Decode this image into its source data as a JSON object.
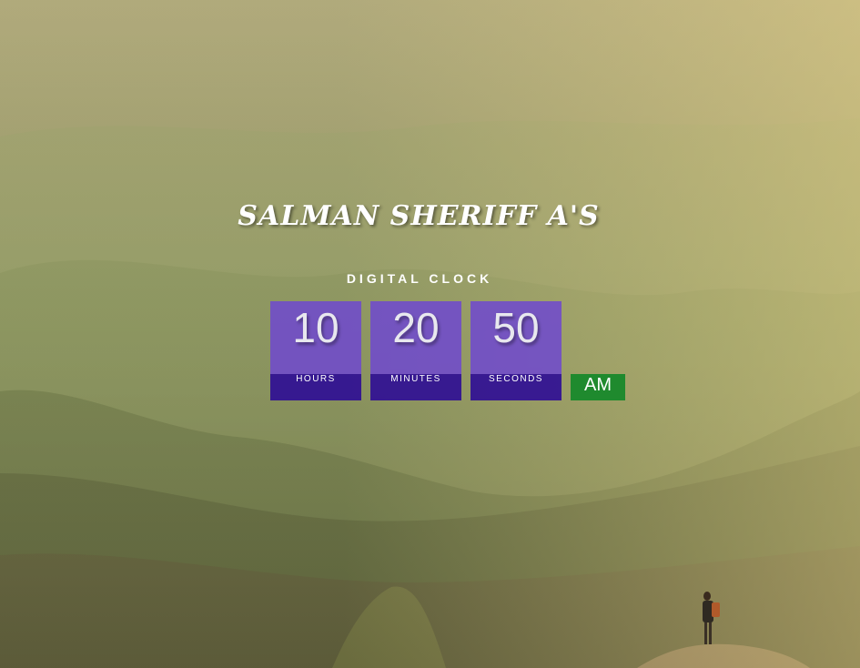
{
  "header": {
    "title": "SALMAN SHERIFF A'S",
    "subtitle": "DIGITAL CLOCK"
  },
  "clock": {
    "hours": {
      "value": "10",
      "label": "HOURS"
    },
    "minutes": {
      "value": "20",
      "label": "MINUTES"
    },
    "seconds": {
      "value": "50",
      "label": "SECONDS"
    },
    "period": "AM"
  },
  "colors": {
    "box_top": "#6e48d0",
    "box_bottom": "#2e0c96",
    "period_bg": "#1f8a2e"
  }
}
